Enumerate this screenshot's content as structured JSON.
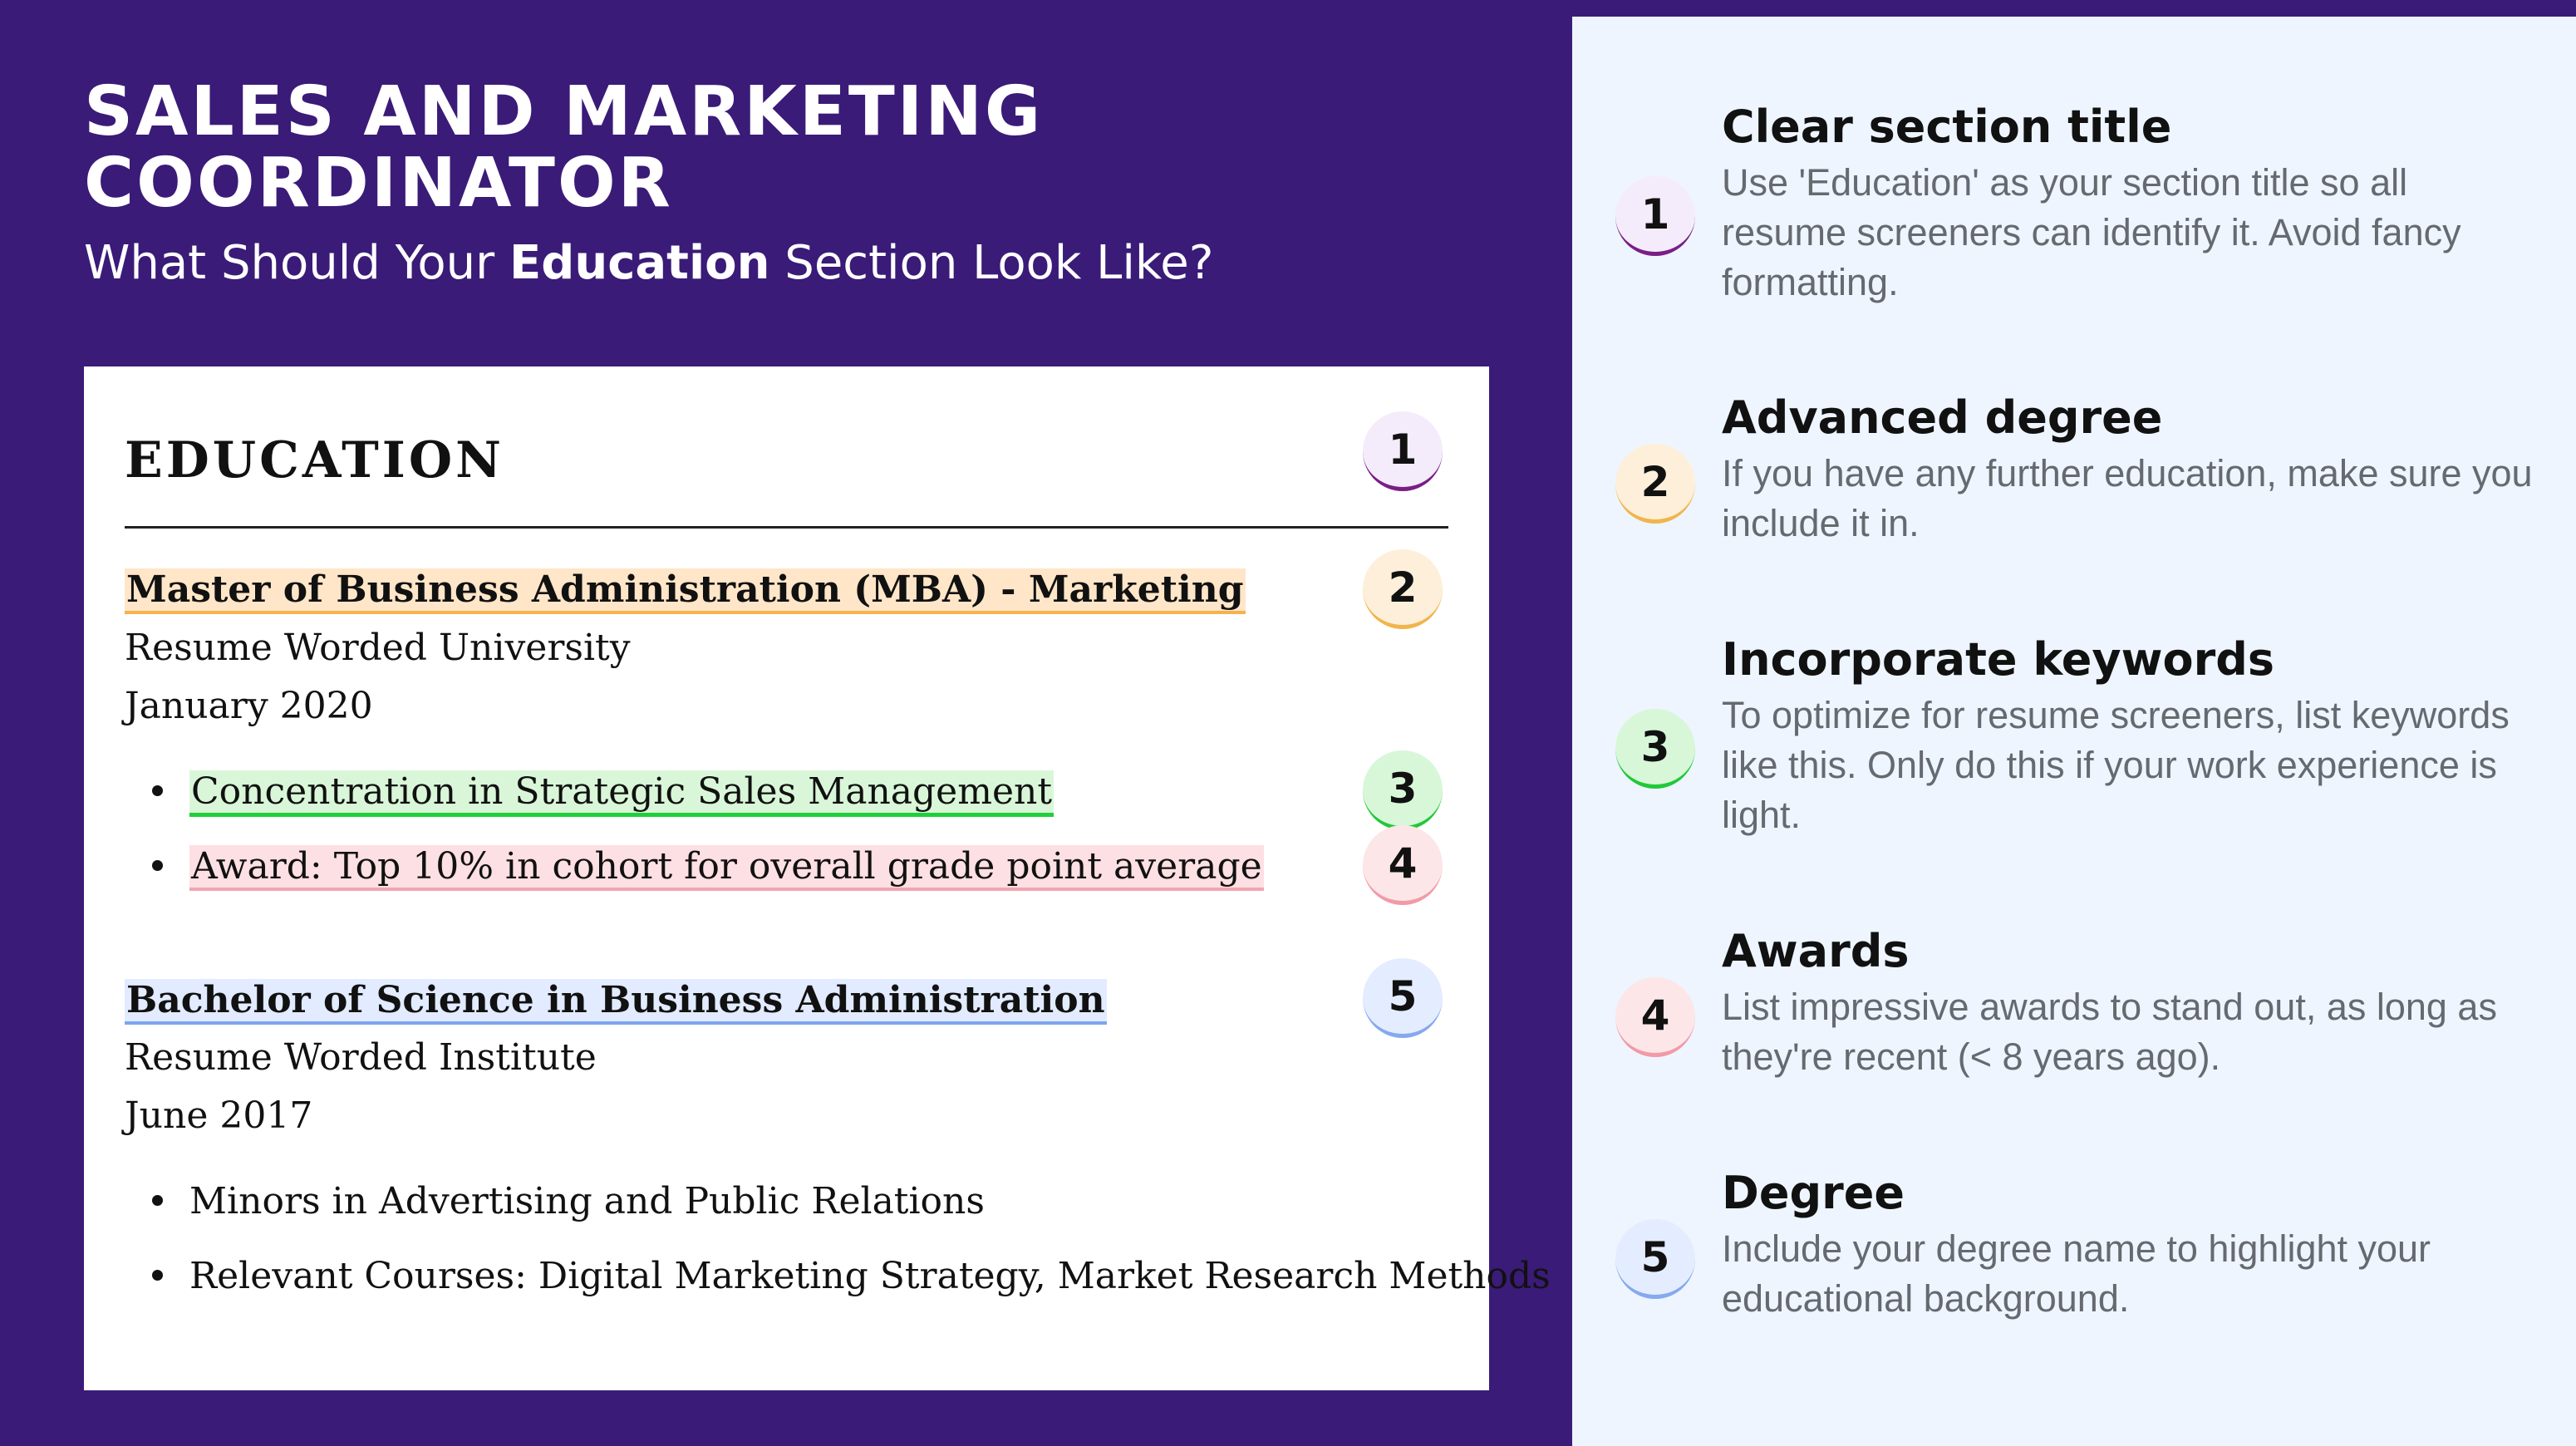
{
  "header": {
    "title_line1": "SALES AND MARKETING",
    "title_line2": "COORDINATOR",
    "subtitle_pre": "What Should Your ",
    "subtitle_bold": "Education",
    "subtitle_post": " Section Look Like?"
  },
  "resume": {
    "heading": "EDUCATION",
    "degree1": {
      "name": "Master of Business Administration (MBA) - Marketing",
      "school": "Resume Worded University",
      "date": "January 2020",
      "bullets": [
        "Concentration in Strategic Sales Management",
        "Award: Top 10% in cohort for overall grade point average"
      ]
    },
    "degree2": {
      "name": "Bachelor of Science in Business Administration",
      "school": "Resume Worded Institute",
      "date": "June 2017",
      "bullets": [
        "Minors in Advertising and Public Relations",
        "Relevant Courses: Digital Marketing Strategy, Market Research Methods"
      ]
    },
    "badges": [
      "1",
      "2",
      "3",
      "4",
      "5"
    ]
  },
  "tips": [
    {
      "number": "1",
      "title": "Clear section title",
      "text": "Use 'Education' as your section title so all resume screeners can identify it. Avoid fancy formatting."
    },
    {
      "number": "2",
      "title": "Advanced degree",
      "text": "If you have any further education, make sure you include it in."
    },
    {
      "number": "3",
      "title": "Incorporate keywords",
      "text": "To optimize for resume screeners, list keywords like this. Only do this if your work experience is light."
    },
    {
      "number": "4",
      "title": "Awards",
      "text": "List impressive awards to stand out, as long as they're recent (< 8 years ago)."
    },
    {
      "number": "5",
      "title": "Degree",
      "text": "Include your degree name to highlight your educational background."
    }
  ],
  "colors": {
    "background": "#3a1b78",
    "panel": "#eef5fe",
    "badge1": "#7a1e87",
    "badge2": "#f0b54c",
    "badge3": "#22c83a",
    "badge4": "#f29aa6",
    "badge5": "#86a8ee"
  }
}
